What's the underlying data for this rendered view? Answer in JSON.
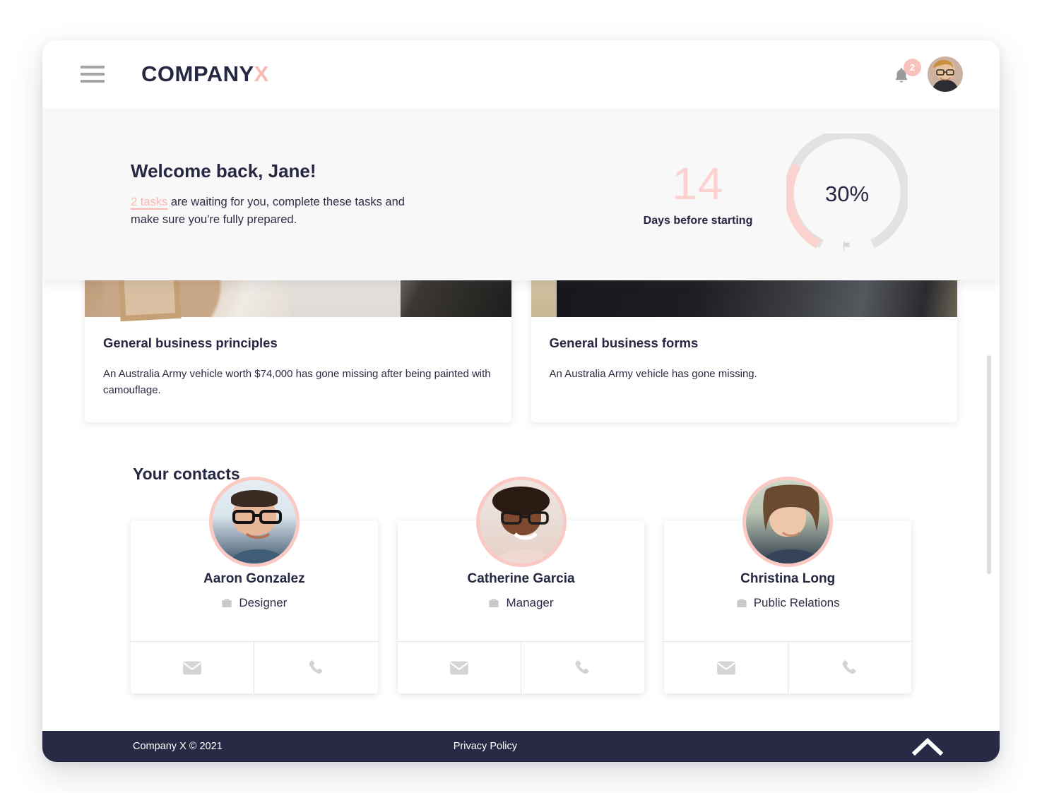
{
  "header": {
    "menu_icon": "hamburger-menu-icon",
    "brand_main": "COMPANY",
    "brand_accent": "X",
    "bell_icon": "notification-bell-icon",
    "notification_count": "2",
    "avatar_label": "user-avatar"
  },
  "welcome": {
    "title": "Welcome back, Jane!",
    "task_link": "2 tasks",
    "sub_rest": " are waiting for you, complete these tasks and make sure you're fully prepared.",
    "days_number": "14",
    "days_label": "Days before starting",
    "progress_percent": "30%",
    "progress_value": 30,
    "flag_icon": "flag-icon"
  },
  "articles": [
    {
      "title": "General business principles",
      "desc": "An Australia Army vehicle worth $74,000 has gone missing after being painted with camouflage."
    },
    {
      "title": "General business forms",
      "desc": "An Australia Army vehicle has gone missing."
    }
  ],
  "contacts": {
    "heading": "Your contacts",
    "items": [
      {
        "name": "Aaron Gonzalez",
        "role": "Designer",
        "email_icon": "envelope-icon",
        "phone_icon": "phone-icon"
      },
      {
        "name": "Catherine Garcia",
        "role": "Manager",
        "email_icon": "envelope-icon",
        "phone_icon": "phone-icon"
      },
      {
        "name": "Christina Long",
        "role": "Public Relations",
        "email_icon": "envelope-icon",
        "phone_icon": "phone-icon"
      }
    ],
    "briefcase_icon": "briefcase-icon"
  },
  "footer": {
    "copyright": "Company X © 2021",
    "privacy": "Privacy Policy",
    "scroll_top_icon": "chevron-up-icon"
  },
  "colors": {
    "accent_pink": "#f9b9b4",
    "accent_pink_light": "#fbd2cd",
    "dark_navy": "#262742",
    "footer_bg": "#282944",
    "panel_bg": "#f8f8f8",
    "gauge_track": "#e2e2e2"
  }
}
